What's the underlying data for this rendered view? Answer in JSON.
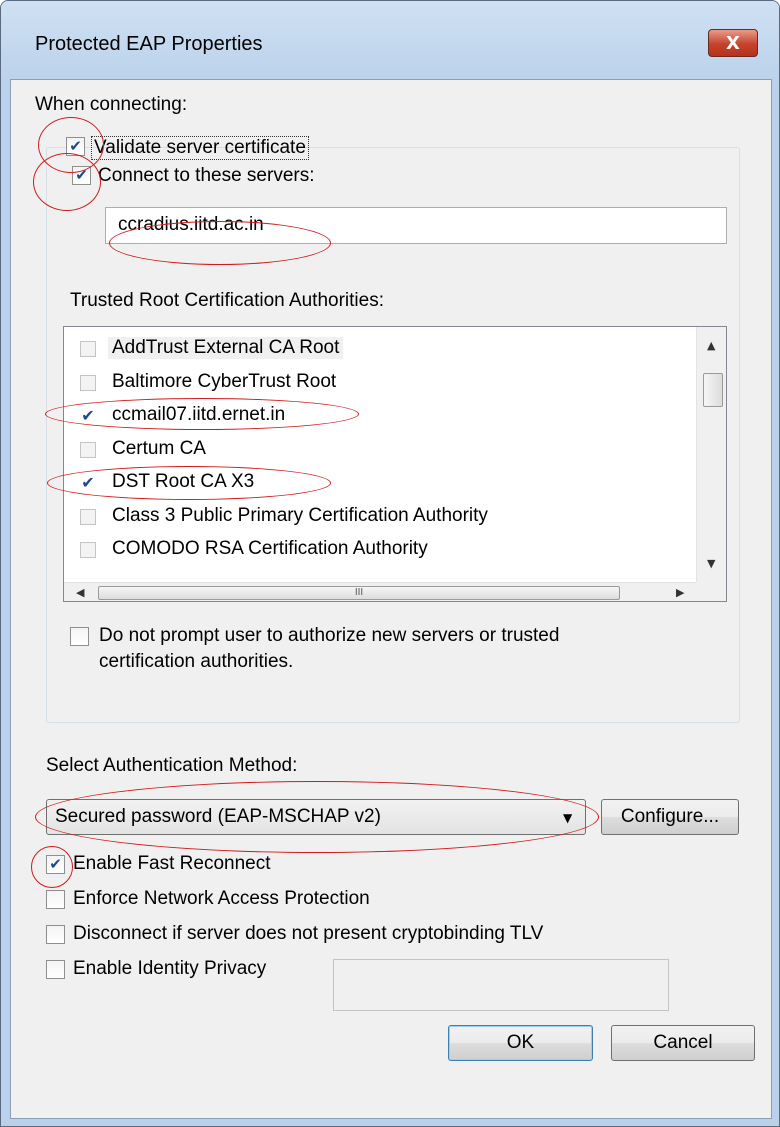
{
  "window": {
    "title": "Protected EAP Properties",
    "close_glyph": "X"
  },
  "section": {
    "when_connecting": "When connecting:",
    "validate_cert": {
      "label": "Validate server certificate",
      "checked": true
    },
    "connect_servers": {
      "label": "Connect to these servers:",
      "checked": true
    },
    "servers_value": "ccradius.iitd.ac.in",
    "trusted_root_label": "Trusted Root Certification Authorities:",
    "trusted_root_list": [
      {
        "label": "AddTrust External CA Root",
        "checked": false
      },
      {
        "label": "Baltimore CyberTrust Root",
        "checked": false
      },
      {
        "label": "ccmail07.iitd.ernet.in",
        "checked": true
      },
      {
        "label": "Certum CA",
        "checked": false
      },
      {
        "label": "DST Root CA X3",
        "checked": true
      },
      {
        "label": "Class 3 Public Primary Certification Authority",
        "checked": false
      },
      {
        "label": "COMODO RSA Certification Authority",
        "checked": false
      }
    ],
    "hscroll_thumb_glyph": "III",
    "do_not_prompt": {
      "line1": "Do not prompt user to authorize new servers or trusted",
      "line2": "certification authorities.",
      "checked": false
    }
  },
  "auth": {
    "label": "Select Authentication Method:",
    "selected": "Secured password (EAP-MSCHAP v2)",
    "configure_label": "Configure..."
  },
  "options": [
    {
      "label": "Enable Fast Reconnect",
      "checked": true
    },
    {
      "label": "Enforce Network Access Protection",
      "checked": false
    },
    {
      "label": "Disconnect if server does not present cryptobinding TLV",
      "checked": false
    },
    {
      "label": "Enable Identity Privacy",
      "checked": false
    }
  ],
  "identity_privacy_value": "",
  "buttons": {
    "ok": "OK",
    "cancel": "Cancel"
  },
  "check_glyph": "✔",
  "annotation_color": "#d01b1b"
}
